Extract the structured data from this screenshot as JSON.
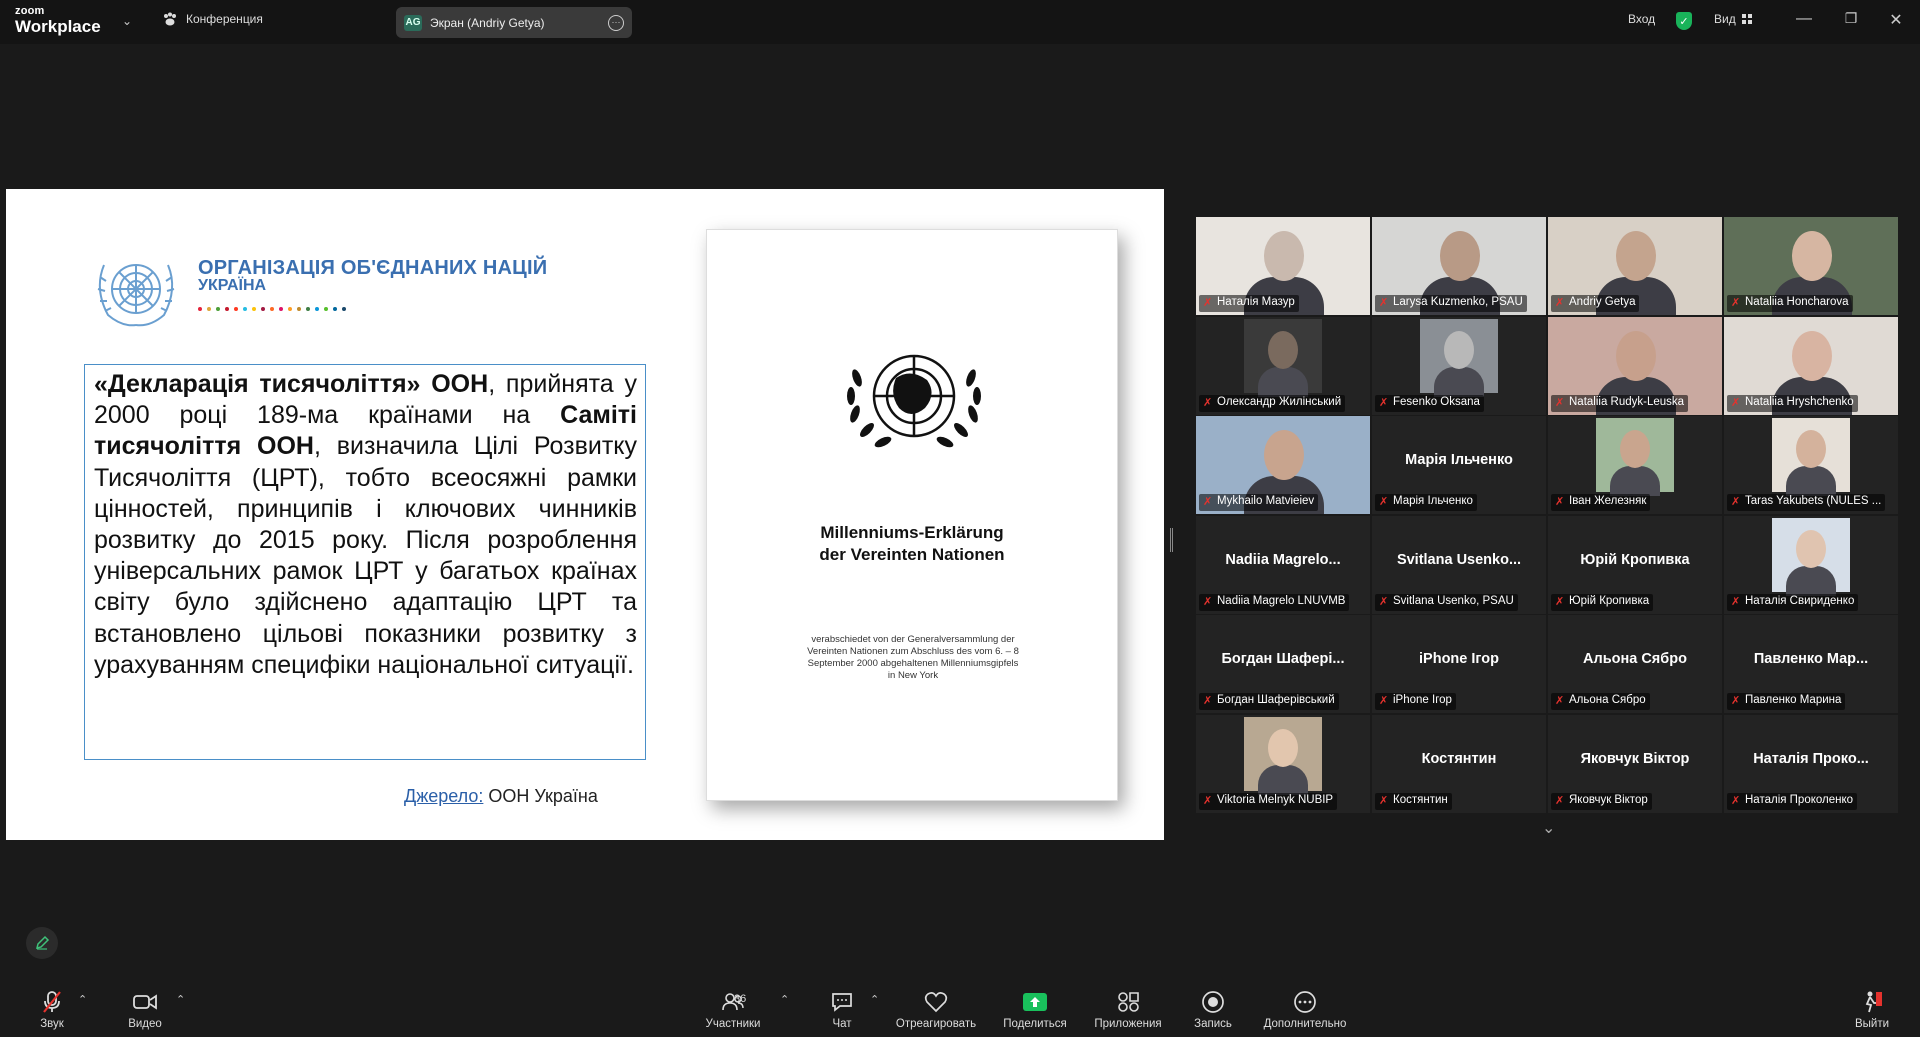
{
  "app": {
    "logo_small": "zoom",
    "logo_big": "Workplace",
    "meeting_menu": "Конференция",
    "share_tab": {
      "initials": "AG",
      "label": "Экран (Andriy Getya)"
    },
    "signin": "Вход",
    "view": "Вид",
    "security_color": "#19b35a"
  },
  "slide": {
    "org_title": "ОРГАНІЗАЦІЯ ОБ'ЄДНАНИХ НАЦІЙ",
    "org_sub": "УКРАЇНА",
    "body_bold1": "«Декларація тисячоліття» ООН",
    "body_text1": ", прийнята у 2000 році 189-ма країнами на ",
    "body_bold2": "Саміті тисячоліття ООН",
    "body_text2": ", визначила Цілі Розвитку Тисячоліття (ЦРТ), тобто всеосяжні рамки цінностей, принципів і ключових чинників розвитку до 2015 року. Після розроблення універсальних рамок ЦРТ у багатьох країнах світу було здійснено адаптацію ЦРТ та встановлено цільові показники розвитку з урахуванням специфіки національної ситуації.",
    "source_link": "Джерело:",
    "source_text": " ООН Україна",
    "doc_title_line1": "Millenniums-Erklärung",
    "doc_title_line2": "der Vereinten Nationen",
    "doc_small": "verabschiedet von der Generalversammlung der Vereinten Nationen zum Abschluss des vom 6. – 8 September 2000 abgehaltenen Millenniumsgipfels in New York"
  },
  "participants": [
    {
      "name": "Наталія Мазур",
      "video": true,
      "tone": "#c9b9ae",
      "bg": "#e8e4df"
    },
    {
      "name": "Larysa Kuzmenko, PSAU",
      "video": true,
      "tone": "#b89a86",
      "bg": "#d6d6d4"
    },
    {
      "name": "Andriy Getya",
      "video": true,
      "tone": "#c4a48e",
      "bg": "#d8d0c6",
      "speaking": true
    },
    {
      "name": "Nataliia Honcharova",
      "video": true,
      "tone": "#d6b6a2",
      "bg": "#5f6f58"
    },
    {
      "name": "Олександр Жилінський",
      "video": true,
      "tone": "#7a6a5e",
      "bg": "#3a3a3a",
      "small": true
    },
    {
      "name": "Fesenko Oksana",
      "video": true,
      "tone": "#b8b8b8",
      "bg": "#8a8f95",
      "small": true
    },
    {
      "name": "Nataliia Rudyk-Leuska",
      "video": true,
      "tone": "#c7a08c",
      "bg": "#c9a9a0"
    },
    {
      "name": "Nataliia Hryshchenko",
      "video": true,
      "tone": "#d8b4a2",
      "bg": "#e0dad4"
    },
    {
      "name": "Mykhailo Matvieiev",
      "video": true,
      "tone": "#c8a48e",
      "bg": "#9ab0c8"
    },
    {
      "name": "Марія Ільченко",
      "big": "Марія Ільченко"
    },
    {
      "name": "Іван Железняк",
      "video": true,
      "tone": "#c9a58e",
      "bg": "#9fb89a",
      "small": true
    },
    {
      "name": "Taras Yakubets (NULES ...",
      "video": true,
      "tone": "#d4b29c",
      "bg": "#e6e0d8",
      "small": true
    },
    {
      "name": "Nadiia Magrelo LNUVMB",
      "big": "Nadiia  Magrelo..."
    },
    {
      "name": "Svitlana Usenko, PSAU",
      "big": "Svitlana  Usenko..."
    },
    {
      "name": "Юрій Кропивка",
      "big": "Юрій Кропивка"
    },
    {
      "name": "Наталія Свириденко",
      "video": true,
      "tone": "#e0c4b0",
      "bg": "#d6dee8",
      "small": true
    },
    {
      "name": "Богдан Шаферівський",
      "big": "Богдан  Шафері..."
    },
    {
      "name": "iPhone Ігор",
      "big": "iPhone Ігор"
    },
    {
      "name": "Альона Сябро",
      "big": "Альона Сябро"
    },
    {
      "name": "Павленко Марина",
      "big": "Павленко  Мар..."
    },
    {
      "name": "Viktoria Melnyk NUBIP",
      "video": true,
      "tone": "#e2c6ae",
      "bg": "#b8a892",
      "small": true
    },
    {
      "name": "Костянтин",
      "big": "Костянтин"
    },
    {
      "name": "Яковчук Віктор",
      "big": "Яковчук Віктор"
    },
    {
      "name": "Наталія Проколенко",
      "big": "Наталія  Проко..."
    }
  ],
  "toolbar": {
    "audio": "Звук",
    "video": "Видео",
    "participants": "Участники",
    "participants_count": "36",
    "chat": "Чат",
    "react": "Отреагировать",
    "share": "Поделиться",
    "apps": "Приложения",
    "record": "Запись",
    "more": "Дополнительно",
    "leave": "Выйти",
    "share_color": "#19c05c"
  }
}
